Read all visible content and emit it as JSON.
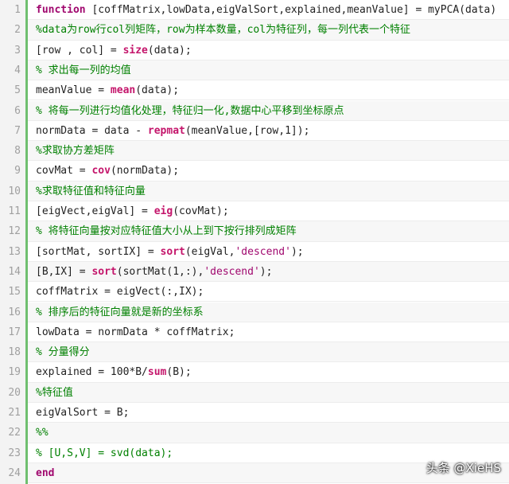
{
  "editor": {
    "lines": [
      {
        "n": "1",
        "segs": [
          {
            "t": "function",
            "c": "kw"
          },
          {
            "t": " [coffMatrix,lowData,eigValSort,explained,meanValue] = myPCA(data)",
            "c": ""
          }
        ]
      },
      {
        "n": "2",
        "segs": [
          {
            "t": "%data为row行col列矩阵，row为样本数量，col为特征列，每一列代表一个特征",
            "c": "cmt"
          }
        ]
      },
      {
        "n": "3",
        "segs": [
          {
            "t": "[row , col] = ",
            "c": ""
          },
          {
            "t": "size",
            "c": "fn"
          },
          {
            "t": "(data);",
            "c": ""
          }
        ]
      },
      {
        "n": "4",
        "segs": [
          {
            "t": "% 求出每一列的均值",
            "c": "cmt"
          }
        ]
      },
      {
        "n": "5",
        "segs": [
          {
            "t": "meanValue = ",
            "c": ""
          },
          {
            "t": "mean",
            "c": "fn"
          },
          {
            "t": "(data);",
            "c": ""
          }
        ]
      },
      {
        "n": "6",
        "segs": [
          {
            "t": "% 将每一列进行均值化处理，特征归一化,数据中心平移到坐标原点",
            "c": "cmt"
          }
        ]
      },
      {
        "n": "7",
        "segs": [
          {
            "t": "normData = data - ",
            "c": ""
          },
          {
            "t": "repmat",
            "c": "fn"
          },
          {
            "t": "(meanValue,[row,1]);",
            "c": ""
          }
        ]
      },
      {
        "n": "8",
        "segs": [
          {
            "t": "%求取协方差矩阵",
            "c": "cmt"
          }
        ]
      },
      {
        "n": "9",
        "segs": [
          {
            "t": "covMat = ",
            "c": ""
          },
          {
            "t": "cov",
            "c": "fn"
          },
          {
            "t": "(normData);",
            "c": ""
          }
        ]
      },
      {
        "n": "10",
        "segs": [
          {
            "t": "%求取特征值和特征向量",
            "c": "cmt"
          }
        ]
      },
      {
        "n": "11",
        "segs": [
          {
            "t": "[eigVect,eigVal] = ",
            "c": ""
          },
          {
            "t": "eig",
            "c": "fn"
          },
          {
            "t": "(covMat);",
            "c": ""
          }
        ]
      },
      {
        "n": "12",
        "segs": [
          {
            "t": "% 将特征向量按对应特征值大小从上到下按行排列成矩阵",
            "c": "cmt"
          }
        ]
      },
      {
        "n": "13",
        "segs": [
          {
            "t": "[sortMat, sortIX] = ",
            "c": ""
          },
          {
            "t": "sort",
            "c": "fn"
          },
          {
            "t": "(eigVal,",
            "c": ""
          },
          {
            "t": "'descend'",
            "c": "str"
          },
          {
            "t": ");",
            "c": ""
          }
        ]
      },
      {
        "n": "14",
        "segs": [
          {
            "t": "[B,IX] = ",
            "c": ""
          },
          {
            "t": "sort",
            "c": "fn"
          },
          {
            "t": "(sortMat(1,:),",
            "c": ""
          },
          {
            "t": "'descend'",
            "c": "str"
          },
          {
            "t": ");",
            "c": ""
          }
        ]
      },
      {
        "n": "15",
        "segs": [
          {
            "t": "coffMatrix = eigVect(:,IX);",
            "c": ""
          }
        ]
      },
      {
        "n": "16",
        "segs": [
          {
            "t": "% 排序后的特征向量就是新的坐标系",
            "c": "cmt"
          }
        ]
      },
      {
        "n": "17",
        "segs": [
          {
            "t": "lowData = normData * coffMatrix;",
            "c": ""
          }
        ]
      },
      {
        "n": "18",
        "segs": [
          {
            "t": "% 分量得分",
            "c": "cmt"
          }
        ]
      },
      {
        "n": "19",
        "segs": [
          {
            "t": "explained = 100*B/",
            "c": ""
          },
          {
            "t": "sum",
            "c": "fn"
          },
          {
            "t": "(B);",
            "c": ""
          }
        ]
      },
      {
        "n": "20",
        "segs": [
          {
            "t": "%特征值",
            "c": "cmt"
          }
        ]
      },
      {
        "n": "21",
        "segs": [
          {
            "t": "eigValSort = B;",
            "c": ""
          }
        ]
      },
      {
        "n": "22",
        "segs": [
          {
            "t": "%%",
            "c": "cmt"
          }
        ]
      },
      {
        "n": "23",
        "segs": [
          {
            "t": "% [U,S,V] = svd(data);",
            "c": "cmt"
          }
        ]
      },
      {
        "n": "24",
        "segs": [
          {
            "t": "end",
            "c": "kw"
          }
        ]
      }
    ]
  },
  "watermark": {
    "text": "头条 @XieHS"
  },
  "colors": {
    "keyword": "#a0076e",
    "builtin": "#c4156b",
    "comment": "#008000",
    "rail": "#6fbf6f"
  }
}
